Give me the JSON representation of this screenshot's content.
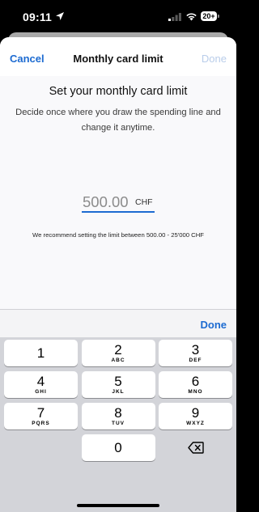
{
  "status_bar": {
    "time": "09:11",
    "battery": "20+"
  },
  "nav": {
    "cancel": "Cancel",
    "title": "Monthly card limit",
    "done": "Done"
  },
  "content": {
    "heading": "Set your monthly card limit",
    "description": "Decide once where you draw the spending line and change it anytime.",
    "amount": "500.00",
    "currency": "CHF",
    "recommendation": "We recommend setting the limit between 500.00 - 25'000 CHF"
  },
  "keyboard": {
    "done": "Done",
    "keys": [
      {
        "digit": "1",
        "letters": ""
      },
      {
        "digit": "2",
        "letters": "ABC"
      },
      {
        "digit": "3",
        "letters": "DEF"
      },
      {
        "digit": "4",
        "letters": "GHI"
      },
      {
        "digit": "5",
        "letters": "JKL"
      },
      {
        "digit": "6",
        "letters": "MNO"
      },
      {
        "digit": "7",
        "letters": "PQRS"
      },
      {
        "digit": "8",
        "letters": "TUV"
      },
      {
        "digit": "9",
        "letters": "WXYZ"
      },
      {
        "digit": "0",
        "letters": ""
      }
    ]
  },
  "icons": {
    "location": "location-arrow-icon",
    "signal": "cellular-signal-icon",
    "wifi": "wifi-icon",
    "backspace": "backspace-icon"
  },
  "colors": {
    "accent": "#1d6bd1",
    "disabled_done": "#b9cdea",
    "keyboard_bg": "#d3d4d9"
  }
}
